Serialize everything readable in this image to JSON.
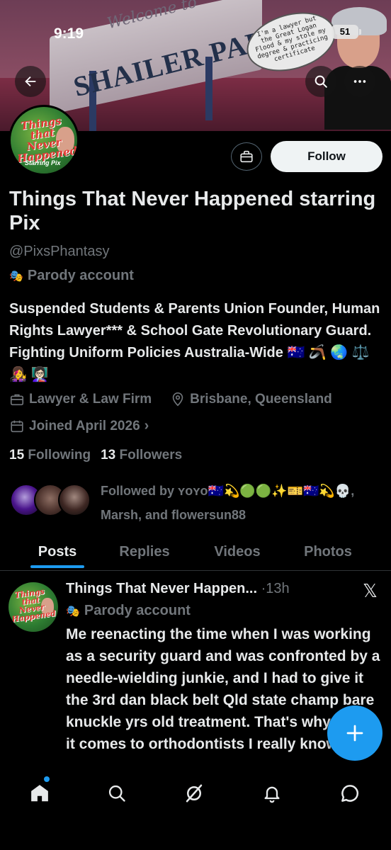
{
  "status_bar": {
    "time": "9:19",
    "battery": "51"
  },
  "banner": {
    "sign_small": "Welcome to",
    "sign_main": "SHAILER PARK",
    "speech_bubble": "I'm a lawyer but the Great Logan Flood & my stole my degree & practicing certificate"
  },
  "profile": {
    "avatar_text": "Things that Never Happened",
    "avatar_sub": "Starring Pix",
    "display_name": "Things That Never Happened starring Pix",
    "handle": "@PixsPhantasy",
    "parody_label": "Parody account",
    "bio": "Suspended Students & Parents Union Founder, Human Rights Lawyer*** & School Gate Revolutionary Guard. Fighting Uniform Policies Australia-Wide 🇦🇺 🪃 🌏 ⚖️ 👩‍🎤 👩🏻‍🏫",
    "category": "Lawyer & Law Firm",
    "location": "Brisbane, Queensland",
    "joined": "Joined April 2026",
    "following_count": "15",
    "following_label": "Following",
    "followers_count": "13",
    "followers_label": "Followers",
    "followed_by": "Followed by ʏᴏʏᴏ🇦🇺💫🟢🟢✨🎫🇦🇺💫💀, Marsh, and flowersun88",
    "follow_button": "Follow"
  },
  "tabs": [
    "Posts",
    "Replies",
    "Videos",
    "Photos"
  ],
  "tweet": {
    "author": "Things That Never Happen...",
    "separator": "·",
    "time": "13h",
    "parody_label": "Parody account",
    "text": "Me reenacting the time when I was working as a security guard and was confronted by a needle-wielding junkie, and I had to give it the 3rd dan black belt Qld state champ bare knuckle yrs old treatment. That's why when it comes to orthodontists I really know"
  },
  "colors": {
    "accent": "#1d9bf0",
    "muted": "#71767b",
    "text": "#e7e9ea",
    "background": "#000000"
  },
  "icons": {
    "back": "back-arrow-icon",
    "search": "search-icon",
    "more": "more-icon",
    "gift": "gift-icon",
    "briefcase": "briefcase-icon",
    "location": "location-pin-icon",
    "calendar": "calendar-icon",
    "compose": "plus-icon",
    "home": "home-icon",
    "explore": "search-icon",
    "grok": "grok-icon",
    "notifications": "bell-icon",
    "messages": "chat-bubble-icon",
    "parody": "theater-mask-icon"
  }
}
